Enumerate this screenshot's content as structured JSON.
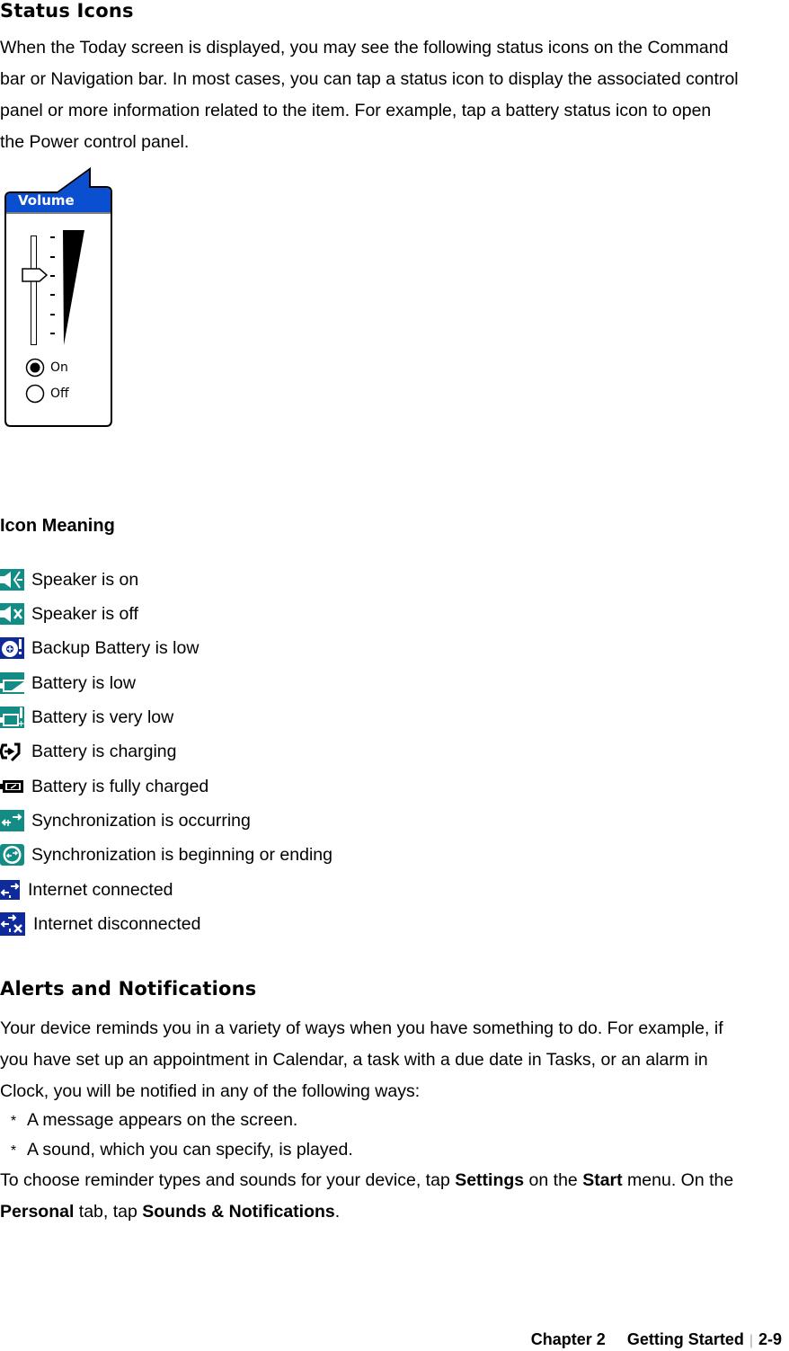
{
  "status_icons": {
    "heading": "Status Icons",
    "intro_lines": [
      "When the Today screen is displayed, you may see the following status icons on the Command",
      "bar or Navigation bar. In most cases, you can tap a status icon to display the associated control",
      "panel or more information related to the item. For example, tap a battery status icon to open",
      "the Power control panel."
    ]
  },
  "volume_panel": {
    "title": "Volume",
    "slider_level_percent": 60,
    "options": [
      {
        "label": "On",
        "selected": true
      },
      {
        "label": "Off",
        "selected": false
      }
    ],
    "title_bar_color": "#0A4FD0"
  },
  "icon_table": {
    "heading": "Icon Meaning",
    "items": [
      {
        "icon": "speaker-on-icon",
        "meaning": "Speaker is on"
      },
      {
        "icon": "speaker-off-icon",
        "meaning": "Speaker is off"
      },
      {
        "icon": "backup-battery-low-icon",
        "meaning": "Backup Battery is low"
      },
      {
        "icon": "battery-low-icon",
        "meaning": "Battery is low"
      },
      {
        "icon": "battery-very-low-icon",
        "meaning": "Battery is very low"
      },
      {
        "icon": "battery-charging-icon",
        "meaning": "Battery is charging"
      },
      {
        "icon": "battery-full-icon",
        "meaning": "Battery is fully charged"
      },
      {
        "icon": "sync-occurring-icon",
        "meaning": "Synchronization is occurring"
      },
      {
        "icon": "sync-begin-end-icon",
        "meaning": "Synchronization is beginning or ending"
      },
      {
        "icon": "internet-connected-icon",
        "meaning": "Internet connected"
      },
      {
        "icon": "internet-disconnected-icon",
        "meaning": "Internet disconnected"
      }
    ],
    "colors": {
      "teal": "#128C84",
      "navy": "#0F2A9A"
    }
  },
  "alerts": {
    "heading": "Alerts and Notifications",
    "intro_lines": [
      "Your device reminds you in a variety of ways when you have something to do. For example, if",
      "you have set up an appointment in Calendar, a task with a due date in Tasks, or an alarm in",
      "Clock, you will be notified in any of the following ways:"
    ],
    "bullet_symbol": "*",
    "bullets": [
      "A message appears on the screen.",
      "A sound, which you can specify, is played."
    ],
    "closing": {
      "t1": "To choose reminder types and sounds for your device, tap ",
      "b1": "Settings",
      "t2": " on the ",
      "b2": "Start",
      "t3": " menu. On the",
      "b3": "Personal",
      "t4": " tab, tap ",
      "b4": "Sounds & Notifications",
      "t5": "."
    }
  },
  "footer": {
    "chapter": "Chapter 2",
    "section": "Getting Started",
    "separator": "|",
    "page": "2-9"
  }
}
